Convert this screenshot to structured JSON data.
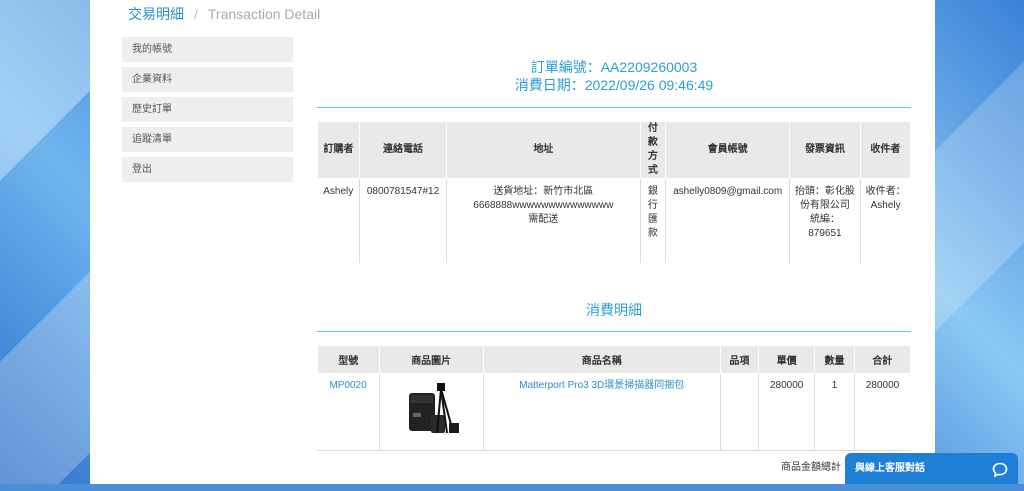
{
  "breadcrumb": {
    "current": "交易明細",
    "separator": "/",
    "english": "Transaction Detail"
  },
  "sidebar": {
    "items": [
      {
        "label": "我的帳號"
      },
      {
        "label": "企業資料"
      },
      {
        "label": "歷史訂單"
      },
      {
        "label": "追蹤清單"
      },
      {
        "label": "登出"
      }
    ]
  },
  "order": {
    "number_line": "訂單編號：AA2209260003",
    "date_line": "消費日期：2022/09/26 09:46:49"
  },
  "info_table": {
    "headers": [
      "訂購者",
      "連絡電話",
      "地址",
      "付款方式",
      "會員帳號",
      "發票資訊",
      "收件者"
    ],
    "buyer": "Ashely",
    "phone": "0800781547#12",
    "address_line1": "送貨地址：新竹市北區",
    "address_line2": "6668888wwwwwwwwwwwwww",
    "address_line3": "需配送",
    "payment": "銀行匯款",
    "member": "ashelly0809@gmail.com",
    "invoice_line1": "抬頭：彰化股份有限公司",
    "invoice_line2": "統編：879651",
    "recipient_line1": "收件者：",
    "recipient_line2": "Ashely"
  },
  "detail": {
    "title": "消費明細"
  },
  "items_table": {
    "headers": [
      "型號",
      "商品圖片",
      "商品名稱",
      "品項",
      "單價",
      "數量",
      "合計"
    ],
    "rows": [
      {
        "model": "MP0020",
        "name": "Matterport Pro3 3D環景掃描器同捆包",
        "variant": "",
        "price": "280000",
        "qty": "1",
        "subtotal": "280000"
      }
    ]
  },
  "summary": {
    "total_label": "商品金額總計"
  },
  "chat": {
    "label": "與線上客服對話",
    "icon": "chat-bubble-icon"
  },
  "colors": {
    "accent": "#2a9fd6",
    "rule": "#5ccbd0",
    "chat_bg": "#1e7fd6"
  }
}
